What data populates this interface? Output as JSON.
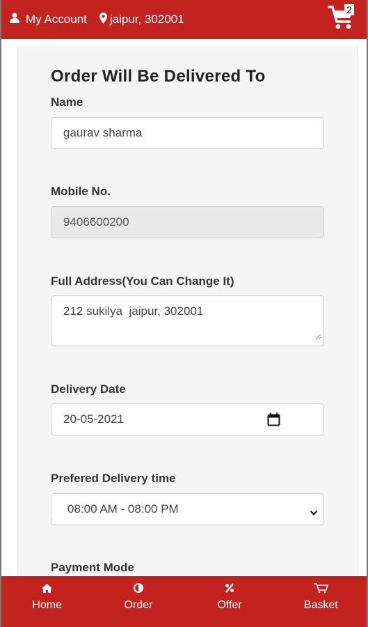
{
  "header": {
    "account_label": "My Account",
    "location_label": "jaipur, 302001",
    "cart_count": "2"
  },
  "form": {
    "title": "Order Will Be Delivered To",
    "name_label": "Name",
    "name_value": "gaurav sharma",
    "mobile_label": "Mobile No.",
    "mobile_value": "9406600200",
    "address_label": "Full Address(You Can Change It)",
    "address_value": "212 sukilya  jaipur, 302001",
    "date_label": "Delivery Date",
    "date_value": "20-05-2021",
    "time_label": "Prefered Delivery time",
    "time_value": "08:00 AM - 08:00 PM",
    "payment_label": "Payment Mode"
  },
  "bottom_nav": {
    "home": "Home",
    "order": "Order",
    "offer": "Offer",
    "basket": "Basket"
  },
  "colors": {
    "brand_red": "#c4221f"
  },
  "icons": [
    "user-icon",
    "map-marker-icon",
    "cart-icon",
    "calendar-icon",
    "chevron-down-icon",
    "home-icon",
    "order-icon",
    "percent-icon",
    "basket-icon"
  ]
}
